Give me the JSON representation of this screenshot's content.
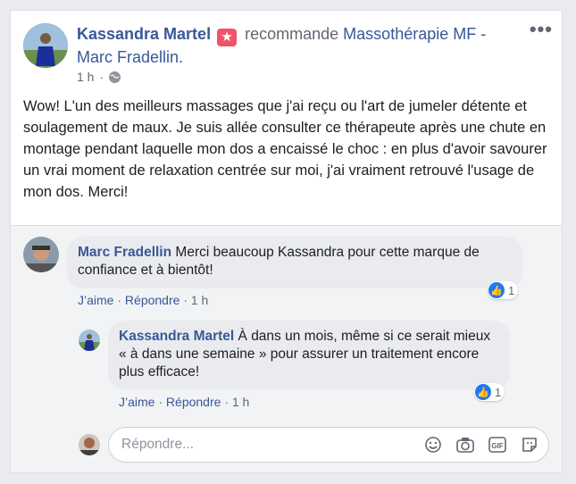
{
  "post": {
    "author": "Kassandra Martel",
    "verb": "recommande",
    "page": "Massothérapie MF - Marc Fradellin.",
    "time": "1 h",
    "text": "Wow! L'un des meilleurs massages que j'ai reçu ou l'art de jumeler détente et soulagement de maux. Je suis allée consulter ce thérapeute après une chute en montage pendant laquelle mon dos a encaissé le choc : en plus d'avoir savourer un vrai moment de relaxation centrée sur moi, j'ai vraiment retrouvé l'usage de mon dos. Merci!",
    "more_icon": "more-options-icon",
    "privacy_icon": "globe-icon"
  },
  "comments": [
    {
      "author": "Marc Fradellin",
      "text": "Merci beaucoup Kassandra pour cette marque de confiance et à bientôt!",
      "like": "J’aime",
      "reply": "Répondre",
      "time": "1 h",
      "reactions": "1"
    },
    {
      "author": "Kassandra Martel",
      "text": "À dans un mois, même si ce serait mieux « à dans une semaine » pour assurer un traitement encore plus efficace!",
      "like": "J’aime",
      "reply": "Répondre",
      "time": "1 h",
      "reactions": "1"
    }
  ],
  "reply_box": {
    "placeholder": "Répondre..."
  },
  "colors": {
    "link": "#385898",
    "like_blue": "#2078f4",
    "badge": "#f25268"
  }
}
